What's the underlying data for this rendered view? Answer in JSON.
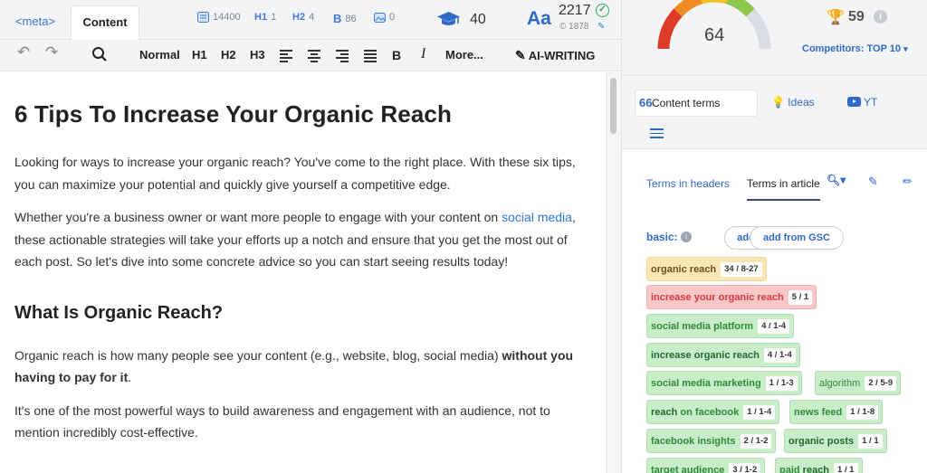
{
  "header": {
    "tabs": [
      "<meta>",
      "Content"
    ],
    "stats": {
      "words": "14400",
      "h1": "1",
      "h2": "4",
      "bold": "86",
      "images": "0"
    },
    "cap_value": "40",
    "aa_label": "Aa",
    "score_primary": "2217",
    "score_secondary": "1878"
  },
  "toolbar": {
    "normal": "Normal",
    "h1": "H1",
    "h2": "H2",
    "h3": "H3",
    "bold": "B",
    "italic": "I",
    "more": "More...",
    "ai_writing": "AI-WRITING"
  },
  "article": {
    "title": "6 Tips To Increase Your Organic Reach",
    "p1": "Looking for ways to increase your organic reach? You've come to the right place. With these six tips, you can maximize your potential and quickly give yourself a competitive edge.",
    "p2_a": "Whether you're a business owner or want more people to engage with your content on ",
    "p2_link": "social media",
    "p2_b": ", these actionable strategies will take your efforts up a notch and ensure that you get the most out of each post. So let's dive into some concrete advice so you can start seeing results today!",
    "h2": "What Is Organic Reach?",
    "p3_a": "Organic reach is how many people see your content (e.g., website, blog, social media) ",
    "p3_bold": "without you having to pay for it",
    "p3_b": ".",
    "p4": "It's one of the most powerful ways to build awareness and engagement with an audience, not to mention incredibly cost-effective."
  },
  "panel": {
    "gauge_value": "64",
    "trophy_value": "59",
    "competitors": "Competitors: TOP 10",
    "tabs": {
      "content_terms": "Content terms",
      "ideas": "Ideas",
      "yt": "YT"
    },
    "subtabs": {
      "headers": "Terms in headers",
      "article": "Terms in article"
    },
    "basic_label": "basic:",
    "add_button": "add",
    "add_gsc_button": "add from GSC",
    "terms": [
      {
        "text": "organic reach",
        "count": "34 / 8-27",
        "status": "yellow"
      },
      {
        "text": "increase your organic reach",
        "count": "5 / 1",
        "status": "red"
      },
      {
        "text": "social media platform",
        "count": "4 / 1-4",
        "status": "green"
      },
      {
        "text": "increase organic reach",
        "count": "4 / 1-4",
        "status": "green"
      },
      {
        "text": "social media marketing",
        "count": "1 / 1-3",
        "status": "green"
      },
      {
        "text": "algorithm",
        "count": "2 / 5-9",
        "status": "green"
      },
      {
        "text_bold": "reach",
        "text_rest": " on facebook",
        "count": "1 / 1-4",
        "status": "green"
      },
      {
        "text": "news feed",
        "count": "1 / 1-8",
        "status": "green"
      },
      {
        "text": "facebook insights",
        "count": "2 / 1-2",
        "status": "green"
      },
      {
        "text": "organic posts",
        "count": "1 / 1",
        "status": "green"
      },
      {
        "text": "target audience",
        "count": "3 / 1-2",
        "status": "green"
      },
      {
        "text_rest": "paid ",
        "text_bold": "reach",
        "count": "1 / 1",
        "status": "green"
      }
    ]
  },
  "colors": {
    "accent": "#2f69c9",
    "green_term": "#c9ecc9",
    "red_term": "#f9c7c7",
    "yellow_term": "#fbe7b5"
  }
}
